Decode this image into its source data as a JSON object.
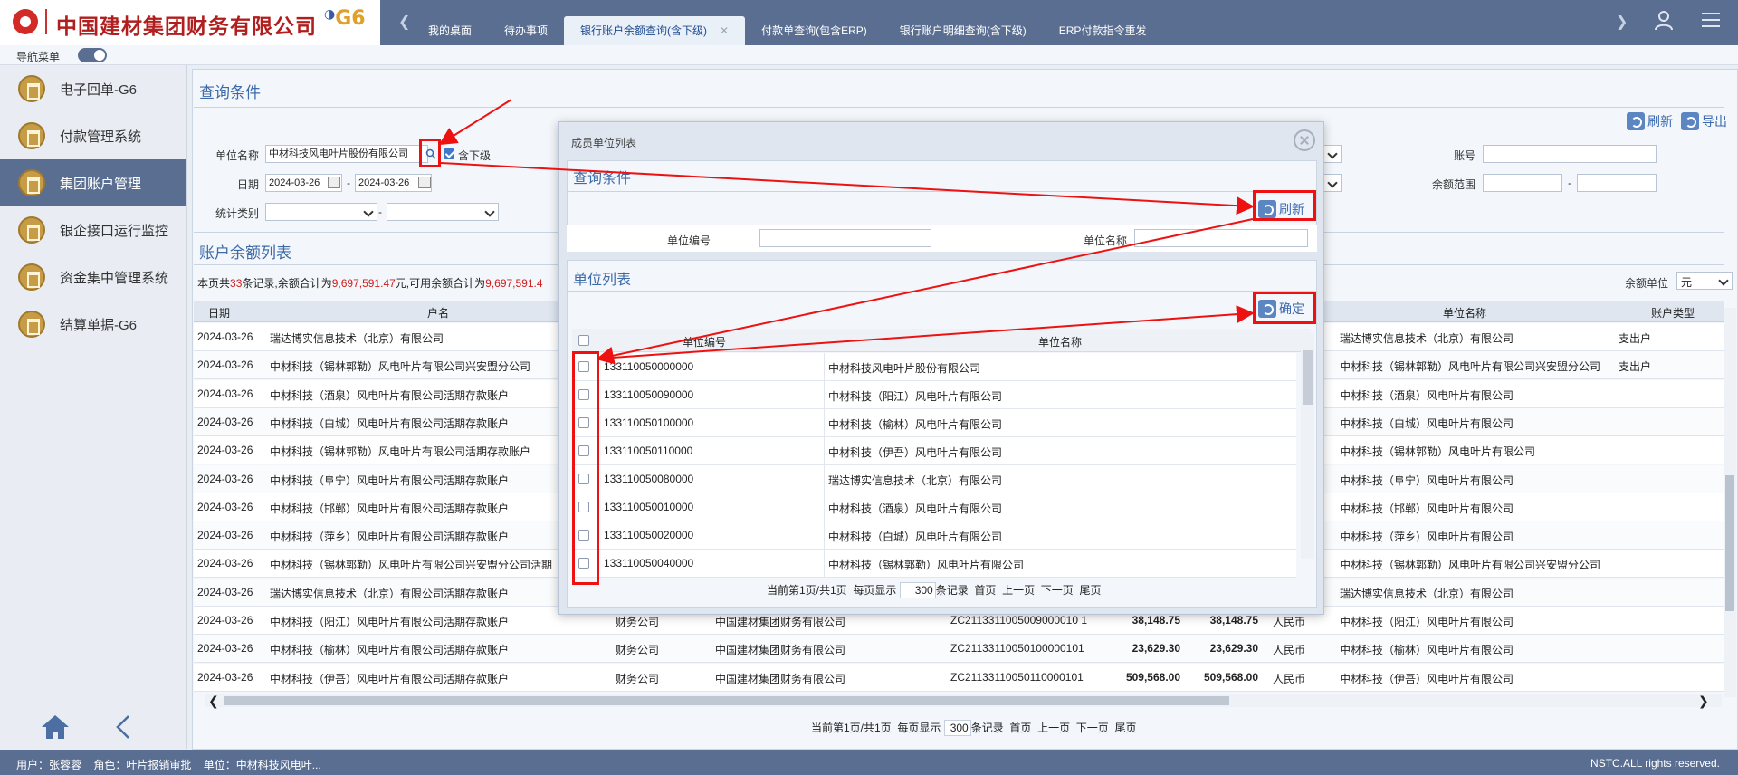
{
  "header": {
    "logo_text": "中国建材集团财务有限公司",
    "product": "G6",
    "tabs": [
      {
        "label": "我的桌面",
        "active": false,
        "closable": false
      },
      {
        "label": "待办事项",
        "active": false,
        "closable": false
      },
      {
        "label": "银行账户余额查询(含下级)",
        "active": true,
        "closable": true
      },
      {
        "label": "付款单查询(包含ERP)",
        "active": false,
        "closable": false
      },
      {
        "label": "银行账户明细查询(含下级)",
        "active": false,
        "closable": false
      },
      {
        "label": "ERP付款指令重发",
        "active": false,
        "closable": false
      }
    ],
    "close_glyph": "✕",
    "icons": {
      "user": "user-icon",
      "menu": "menu-icon",
      "left": "chevron-left-icon",
      "right": "chevron-right-icon"
    }
  },
  "navstrip": {
    "label": "导航菜单",
    "toggle_on": true
  },
  "sidebar": {
    "items": [
      {
        "label": "电子回单-G6",
        "active": false
      },
      {
        "label": "付款管理系统",
        "active": false
      },
      {
        "label": "集团账户管理",
        "active": true
      },
      {
        "label": "银企接口运行监控",
        "active": false
      },
      {
        "label": "资金集中管理系统",
        "active": false
      },
      {
        "label": "结算单据-G6",
        "active": false
      }
    ]
  },
  "query": {
    "title": "查询条件",
    "refresh_label": "刷新",
    "export_label": "导出",
    "unit_label": "单位名称",
    "unit_value": "中材科技风电叶片股份有限公司",
    "include_sub_label": "含下级",
    "include_sub_checked": true,
    "date_label": "日期",
    "date_from": "2024-03-26",
    "date_sep": "-",
    "date_to": "2024-03-26",
    "stat_label": "统计类别",
    "stat_sep": "-",
    "account_label": "账号",
    "balance_range_label": "余额范围",
    "balance_sep": "-"
  },
  "list": {
    "title": "账户余额列表",
    "summary": {
      "prefix": "本页共",
      "count": "33",
      "mid1": "条记录,余额合计为",
      "total": "9,697,591.47",
      "mid2": "元,可用余额合计为",
      "available": "9,697,591.4"
    },
    "unit_label": "余额单位",
    "unit_value": "元",
    "columns": {
      "date": "日期",
      "name": "户名",
      "unit_name": "单位名称",
      "acct_type": "账户类型"
    },
    "rows": [
      {
        "date": "2024-03-26",
        "name": "瑞达博实信息技术（北京）有限公司",
        "bank": "",
        "org": "",
        "acct": "",
        "bal": "",
        "avail": "",
        "cur": "",
        "unit": "瑞达博实信息技术（北京）有限公司",
        "type": "支出户"
      },
      {
        "date": "2024-03-26",
        "name": "中材科技（锡林郭勒）风电叶片有限公司兴安盟分公司",
        "bank": "",
        "org": "",
        "acct": "",
        "bal": "",
        "avail": "",
        "cur": "",
        "unit": "中材科技（锡林郭勒）风电叶片有限公司兴安盟分公司",
        "type": "支出户"
      },
      {
        "date": "2024-03-26",
        "name": "中材科技（酒泉）风电叶片有限公司活期存款账户",
        "bank": "",
        "org": "",
        "acct": "",
        "bal": "",
        "avail": "",
        "cur": "",
        "unit": "中材科技（酒泉）风电叶片有限公司",
        "type": ""
      },
      {
        "date": "2024-03-26",
        "name": "中材科技（白城）风电叶片有限公司活期存款账户",
        "bank": "",
        "org": "",
        "acct": "",
        "bal": "",
        "avail": "",
        "cur": "",
        "unit": "中材科技（白城）风电叶片有限公司",
        "type": ""
      },
      {
        "date": "2024-03-26",
        "name": "中材科技（锡林郭勒）风电叶片有限公司活期存款账户",
        "bank": "",
        "org": "",
        "acct": "",
        "bal": "",
        "avail": "",
        "cur": "",
        "unit": "中材科技（锡林郭勒）风电叶片有限公司",
        "type": ""
      },
      {
        "date": "2024-03-26",
        "name": "中材科技（阜宁）风电叶片有限公司活期存款账户",
        "bank": "",
        "org": "",
        "acct": "",
        "bal": "",
        "avail": "",
        "cur": "",
        "unit": "中材科技（阜宁）风电叶片有限公司",
        "type": ""
      },
      {
        "date": "2024-03-26",
        "name": "中材科技（邯郸）风电叶片有限公司活期存款账户",
        "bank": "",
        "org": "",
        "acct": "",
        "bal": "",
        "avail": "",
        "cur": "",
        "unit": "中材科技（邯郸）风电叶片有限公司",
        "type": ""
      },
      {
        "date": "2024-03-26",
        "name": "中材科技（萍乡）风电叶片有限公司活期存款账户",
        "bank": "",
        "org": "",
        "acct": "",
        "bal": "",
        "avail": "",
        "cur": "",
        "unit": "中材科技（萍乡）风电叶片有限公司",
        "type": ""
      },
      {
        "date": "2024-03-26",
        "name": "中材科技（锡林郭勒）风电叶片有限公司兴安盟分公司活期",
        "bank": "",
        "org": "",
        "acct": "",
        "bal": "",
        "avail": "",
        "cur": "",
        "unit": "中材科技（锡林郭勒）风电叶片有限公司兴安盟分公司",
        "type": ""
      },
      {
        "date": "2024-03-26",
        "name": "瑞达博实信息技术（北京）有限公司活期存款账户",
        "bank": "",
        "org": "",
        "acct": "",
        "bal": "",
        "avail": "",
        "cur": "",
        "unit": "瑞达博实信息技术（北京）有限公司",
        "type": ""
      },
      {
        "date": "2024-03-26",
        "name": "中材科技（阳江）风电叶片有限公司活期存款账户",
        "bank": "财务公司",
        "org": "中国建材集团财务有限公司",
        "acct": "ZC2113311005009000010 1",
        "bal": "38,148.75",
        "avail": "38,148.75",
        "cur": "人民币",
        "unit": "中材科技（阳江）风电叶片有限公司",
        "type": ""
      },
      {
        "date": "2024-03-26",
        "name": "中材科技（榆林）风电叶片有限公司活期存款账户",
        "bank": "财务公司",
        "org": "中国建材集团财务有限公司",
        "acct": "ZC21133110050100000101",
        "bal": "23,629.30",
        "avail": "23,629.30",
        "cur": "人民币",
        "unit": "中材科技（榆林）风电叶片有限公司",
        "type": ""
      },
      {
        "date": "2024-03-26",
        "name": "中材科技（伊吾）风电叶片有限公司活期存款账户",
        "bank": "财务公司",
        "org": "中国建材集团财务有限公司",
        "acct": "ZC21133110050110000101",
        "bal": "509,568.00",
        "avail": "509,568.00",
        "cur": "人民币",
        "unit": "中材科技（伊吾）风电叶片有限公司",
        "type": ""
      }
    ],
    "pager": {
      "text1": "当前第1页/共1页",
      "text2": "每页显示",
      "size": "300",
      "text3": "条记录",
      "first": "首页",
      "prev": "上一页",
      "next": "下一页",
      "last": "尾页"
    }
  },
  "modal": {
    "title": "成员单位列表",
    "query_title": "查询条件",
    "refresh_label": "刷新",
    "code_label": "单位编号",
    "name_label": "单位名称",
    "list_title": "单位列表",
    "confirm_label": "确定",
    "columns": {
      "code": "单位编号",
      "name": "单位名称"
    },
    "rows": [
      {
        "code": "133110050000000",
        "name": "中材科技风电叶片股份有限公司"
      },
      {
        "code": "133110050090000",
        "name": "中材科技（阳江）风电叶片有限公司"
      },
      {
        "code": "133110050100000",
        "name": "中材科技（榆林）风电叶片有限公司"
      },
      {
        "code": "133110050110000",
        "name": "中材科技（伊吾）风电叶片有限公司"
      },
      {
        "code": "133110050080000",
        "name": "瑞达博实信息技术（北京）有限公司"
      },
      {
        "code": "133110050010000",
        "name": "中材科技（酒泉）风电叶片有限公司"
      },
      {
        "code": "133110050020000",
        "name": "中材科技（白城）风电叶片有限公司"
      },
      {
        "code": "133110050040000",
        "name": "中材科技（锡林郭勒）风电叶片有限公司"
      }
    ],
    "pager": {
      "text1": "当前第1页/共1页",
      "text2": "每页显示",
      "size": "300",
      "text3": "条记录",
      "first": "首页",
      "prev": "上一页",
      "next": "下一页",
      "last": "尾页"
    }
  },
  "footer": {
    "user": "用户：张蓉蓉",
    "role": "角色：叶片报销审批",
    "unit": "单位：中材科技风电叶...",
    "rights": "NSTC.ALL rights reserved."
  },
  "colors": {
    "header": "#5a6e92",
    "accent_blue": "#3d6aa8",
    "annotation_red": "#e11111",
    "amount_red": "#d11c1c"
  }
}
